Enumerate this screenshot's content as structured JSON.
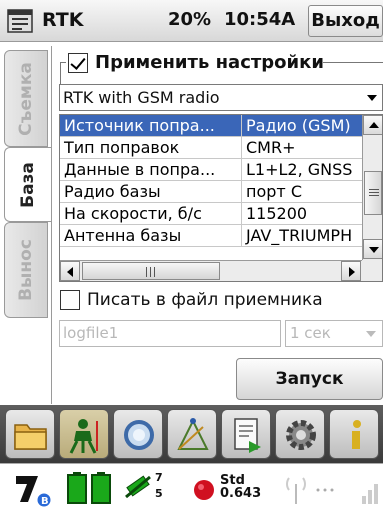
{
  "titlebar": {
    "app_title": "RTK",
    "battery": "20%",
    "clock": "10:54A",
    "exit_label": "Выход"
  },
  "tabs": [
    {
      "label": "Съемка",
      "active": false
    },
    {
      "label": "База",
      "active": true
    },
    {
      "label": "Вынос",
      "active": false
    }
  ],
  "settings": {
    "apply_label": "Применить настройки",
    "apply_checked": true,
    "profile": "RTK with GSM radio"
  },
  "table": {
    "rows": [
      {
        "name": "Источник попра...",
        "value": "Радио (GSM)",
        "selected": true
      },
      {
        "name": "Тип поправок",
        "value": "CMR+",
        "selected": false
      },
      {
        "name": "Данные в попра...",
        "value": "L1+L2, GNSS",
        "selected": false
      },
      {
        "name": "Радио базы",
        "value": "порт C",
        "selected": false
      },
      {
        "name": "На скорости, б/с",
        "value": "115200",
        "selected": false
      },
      {
        "name": "Антенна базы",
        "value": "JAV_TRIUMPH",
        "selected": false
      }
    ],
    "hscroll_thumb_label": "III"
  },
  "log": {
    "write_label": "Писать в файл приемника",
    "write_checked": false,
    "filename": "logfile1",
    "interval": "1 сек"
  },
  "start_label": "Запуск",
  "toolbar": {
    "tools": [
      "folder-icon",
      "surveyor-icon",
      "search-icon",
      "cogo-icon",
      "export-icon",
      "settings-gear-icon",
      "info-icon"
    ]
  },
  "status": {
    "satellites_top": "7",
    "satellites_bottom": "5",
    "solution": "Std",
    "precision": "0.643",
    "colors": {
      "green": "#1aa81a",
      "red": "#d01020",
      "selection": "#3a66b8"
    }
  }
}
